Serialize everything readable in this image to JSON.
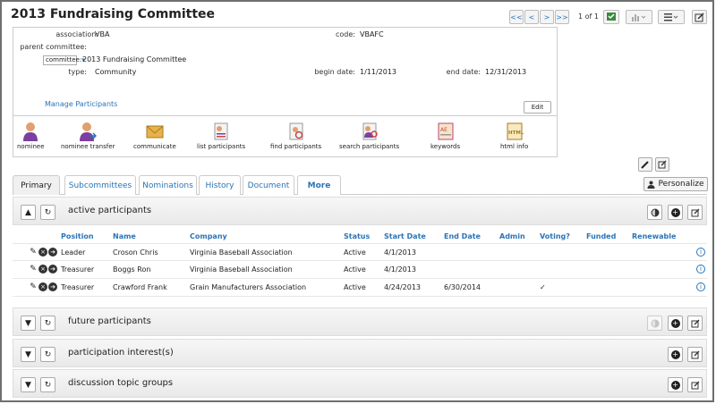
{
  "header": {
    "title": "2013 Fundraising Committee",
    "pager": {
      "first": "<<",
      "prev": "<",
      "next": ">",
      "last": ">>",
      "count": "1 of 1"
    }
  },
  "details": {
    "association_label": "association:",
    "association_value": "VBA",
    "code_label": "code:",
    "code_value": "VBAFC",
    "parent_label": "parent committee:",
    "committee_select": "committee:",
    "committee_name": "2013 Fundraising Committee",
    "type_label": "type:",
    "type_value": "Community",
    "begin_label": "begin date:",
    "begin_value": "1/11/2013",
    "end_label": "end date:",
    "end_value": "12/31/2013",
    "manage_link": "Manage Participants",
    "edit_label": "Edit"
  },
  "actions": [
    {
      "label": "nominee",
      "icon": "person-icon"
    },
    {
      "label": "nominee transfer",
      "icon": "person-transfer-icon"
    },
    {
      "label": "communicate",
      "icon": "envelope-icon"
    },
    {
      "label": "list participants",
      "icon": "list-icon"
    },
    {
      "label": "find participants",
      "icon": "find-icon"
    },
    {
      "label": "search participants",
      "icon": "search-people-icon"
    },
    {
      "label": "keywords",
      "icon": "keywords-icon"
    },
    {
      "label": "html info",
      "icon": "html-icon"
    }
  ],
  "tabs": [
    "Primary",
    "Subcommittees",
    "Nominations",
    "History",
    "Document",
    "More"
  ],
  "personalize_label": "Personalize",
  "sections": {
    "active": "active participants",
    "future": "future participants",
    "interest": "participation interest(s)",
    "discussion": "discussion topic groups"
  },
  "table": {
    "columns": [
      "Position",
      "Name",
      "Company",
      "Status",
      "Start Date",
      "End Date",
      "Admin",
      "Voting?",
      "Funded",
      "Renewable"
    ],
    "rows": [
      {
        "position": "Leader",
        "name": "Croson Chris",
        "company": "Virginia Baseball Association",
        "status": "Active",
        "start": "4/1/2013",
        "end": "",
        "voting": ""
      },
      {
        "position": "Treasurer",
        "name": "Boggs Ron",
        "company": "Virginia Baseball Association",
        "status": "Active",
        "start": "4/1/2013",
        "end": "",
        "voting": ""
      },
      {
        "position": "Treasurer",
        "name": "Crawford Frank",
        "company": "Grain Manufacturers Association",
        "status": "Active",
        "start": "4/24/2013",
        "end": "6/30/2014",
        "voting": "✓"
      }
    ]
  },
  "colors": {
    "link": "#2a74b8",
    "frame": "#6f6f6f"
  }
}
